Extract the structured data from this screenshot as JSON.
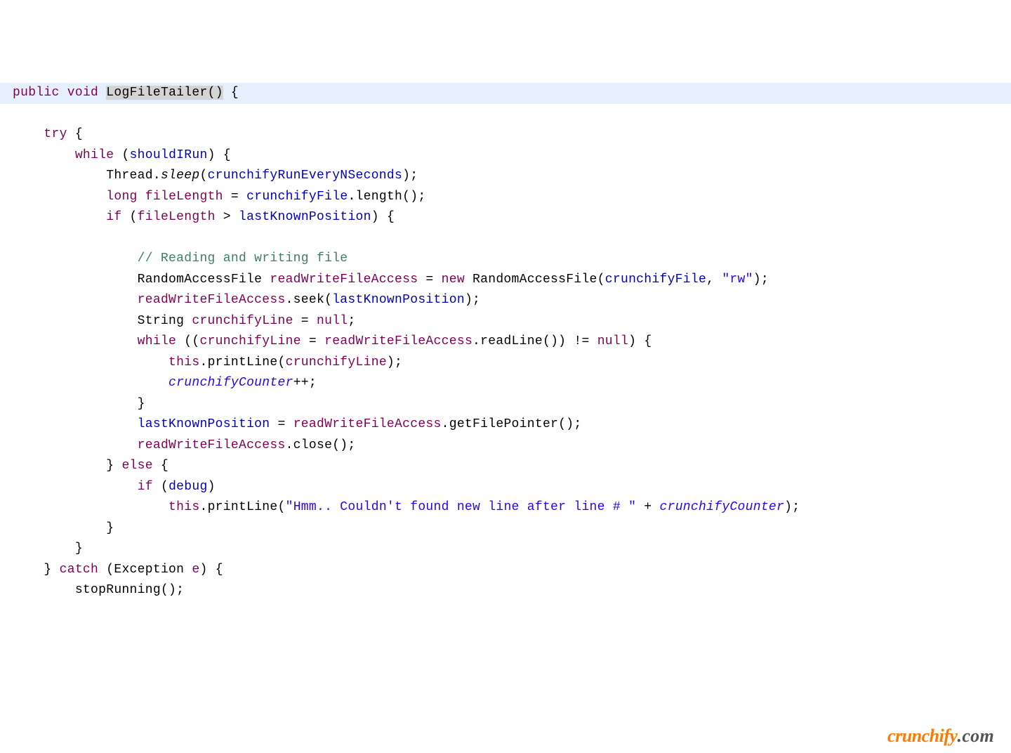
{
  "code": {
    "l1": "public void LogFileTailer() {",
    "l1a": "public",
    "l1b": " ",
    "l1c": "void",
    "l1d": " ",
    "l1e": "LogFileTailer(",
    "l1f": ")",
    "l1g": " {",
    "l2": "    try {",
    "l2a": "try",
    "l2b": " {",
    "l3a": "while",
    "l3b": " (",
    "l3c": "shouldIRun",
    "l3d": ") {",
    "l4a": "            Thread.",
    "l4b": "sleep",
    "l4c": "(",
    "l4d": "crunchifyRunEveryNSeconds",
    "l4e": ");",
    "l5a": "long",
    "l5b": " ",
    "l5c": "fileLength",
    "l5d": " = ",
    "l5e": "crunchifyFile",
    "l5f": ".length();",
    "l6a": "if",
    "l6b": " (",
    "l6c": "fileLength",
    "l6d": " > ",
    "l6e": "lastKnownPosition",
    "l6f": ") {",
    "l7": "",
    "l8": "                // Reading and writing file",
    "l9a": "                RandomAccessFile ",
    "l9b": "readWriteFileAccess",
    "l9c": " = ",
    "l9d": "new",
    "l9e": " RandomAccessFile(",
    "l9f": "crunchifyFile",
    "l9g": ", ",
    "l9h": "\"rw\"",
    "l9i": ");",
    "l10a": "readWriteFileAccess",
    "l10b": ".seek(",
    "l10c": "lastKnownPosition",
    "l10d": ");",
    "l11a": "                String ",
    "l11b": "crunchifyLine",
    "l11c": " = ",
    "l11d": "null",
    "l11e": ";",
    "l12a": "while",
    "l12b": " ((",
    "l12c": "crunchifyLine",
    "l12d": " = ",
    "l12e": "readWriteFileAccess",
    "l12f": ".readLine()) != ",
    "l12g": "null",
    "l12h": ") {",
    "l13a": "this",
    "l13b": ".printLine(",
    "l13c": "crunchifyLine",
    "l13d": ");",
    "l14a": "crunchifyCounter",
    "l14b": "++;",
    "l15": "                }",
    "l16a": "lastKnownPosition",
    "l16b": " = ",
    "l16c": "readWriteFileAccess",
    "l16d": ".getFilePointer();",
    "l17a": "readWriteFileAccess",
    "l17b": ".close();",
    "l18a": "            } ",
    "l18b": "else",
    "l18c": " {",
    "l19a": "if",
    "l19b": " (",
    "l19c": "debug",
    "l19d": ")",
    "l20a": "this",
    "l20b": ".printLine(",
    "l20c": "\"Hmm.. Couldn't found new line after line # \"",
    "l20d": " + ",
    "l20e": "crunchifyCounter",
    "l20f": ");",
    "l21": "            }",
    "l22": "        }",
    "l23a": "    } ",
    "l23b": "catch",
    "l23c": " (Exception ",
    "l23d": "e",
    "l23e": ") {",
    "l24": "        stopRunning();"
  },
  "watermark": {
    "brand": "crunchify",
    "dotcom": ".com"
  }
}
